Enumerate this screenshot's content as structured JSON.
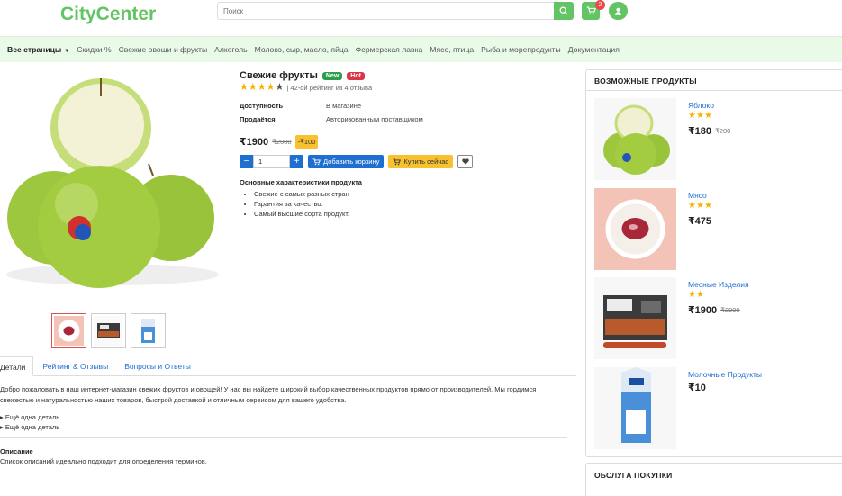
{
  "header": {
    "logo": "CityCenter",
    "search_placeholder": "Поиск",
    "cart_count": "2"
  },
  "nav": {
    "items": [
      "Все страницы",
      "Скидки %",
      "Свежие овощи и фрукты",
      "Алкоголь",
      "Молоко, сыр, масло, яйца",
      "Фермерская лавка",
      "Мясо, птица",
      "Рыба и морепродукты",
      "Документация"
    ]
  },
  "product": {
    "title": "Свежие фрукты",
    "badge_new": "New",
    "badge_hot": "Hot",
    "rating": 4,
    "rating_text": "| 42-ой рейтинг из 4 отзыва",
    "availability_label": "Доступность",
    "availability_value": "В магазине",
    "seller_label": "Продаётся",
    "seller_value": "Авторизованным поставщиком",
    "price": "₹1900",
    "old_price": "₹2000",
    "discount": "-₹100",
    "qty": "1",
    "add_to_cart": "Добавить корзину",
    "buy_now": "Купить сейчас",
    "features_title": "Основные характеристики продукта",
    "features": [
      "Свежие с самых разных стран",
      "Гарантия за качество.",
      "Самый высшие сорта продукт."
    ]
  },
  "tabs": {
    "details": "Детали",
    "reviews": "Рейтинг & Отзывы",
    "qa": "Вопросы и Ответы"
  },
  "description": {
    "text": "Добро пожаловать в наш интернет-магазин свежих фруктов и овощей! У нас вы найдете широкий выбор качественных продуктов прямо от производителей. Мы гордимся свежестью и натуральностью наших товаров, быстрой доставкой и отличным сервисом для вашего удобства.",
    "detail_1": "Ещё одна деталь",
    "detail_2": "Ещё одна деталь",
    "opis_title": "Описание",
    "opis_text": "Список описаний идеально подходит для определения терминов."
  },
  "sidebar": {
    "title": "ВОЗМОЖНЫЕ ПРОДУКТЫ",
    "items": [
      {
        "name": "Яблоко",
        "stars": 3,
        "price": "₹180",
        "old_price": "₹200"
      },
      {
        "name": "Мясо",
        "stars": 3,
        "price": "₹475",
        "old_price": ""
      },
      {
        "name": "Месные Изделия",
        "stars": 2,
        "price": "₹1900",
        "old_price": "₹2000"
      },
      {
        "name": "Молочные Продукты",
        "stars": 0,
        "price": "₹10",
        "old_price": ""
      }
    ],
    "service_title": "ОБСЛУГА ПОКУПКИ"
  },
  "colors": {
    "brand": "#62c462",
    "primary": "#1f6fd1",
    "warning": "#f7c12f",
    "star": "#f5b301"
  }
}
